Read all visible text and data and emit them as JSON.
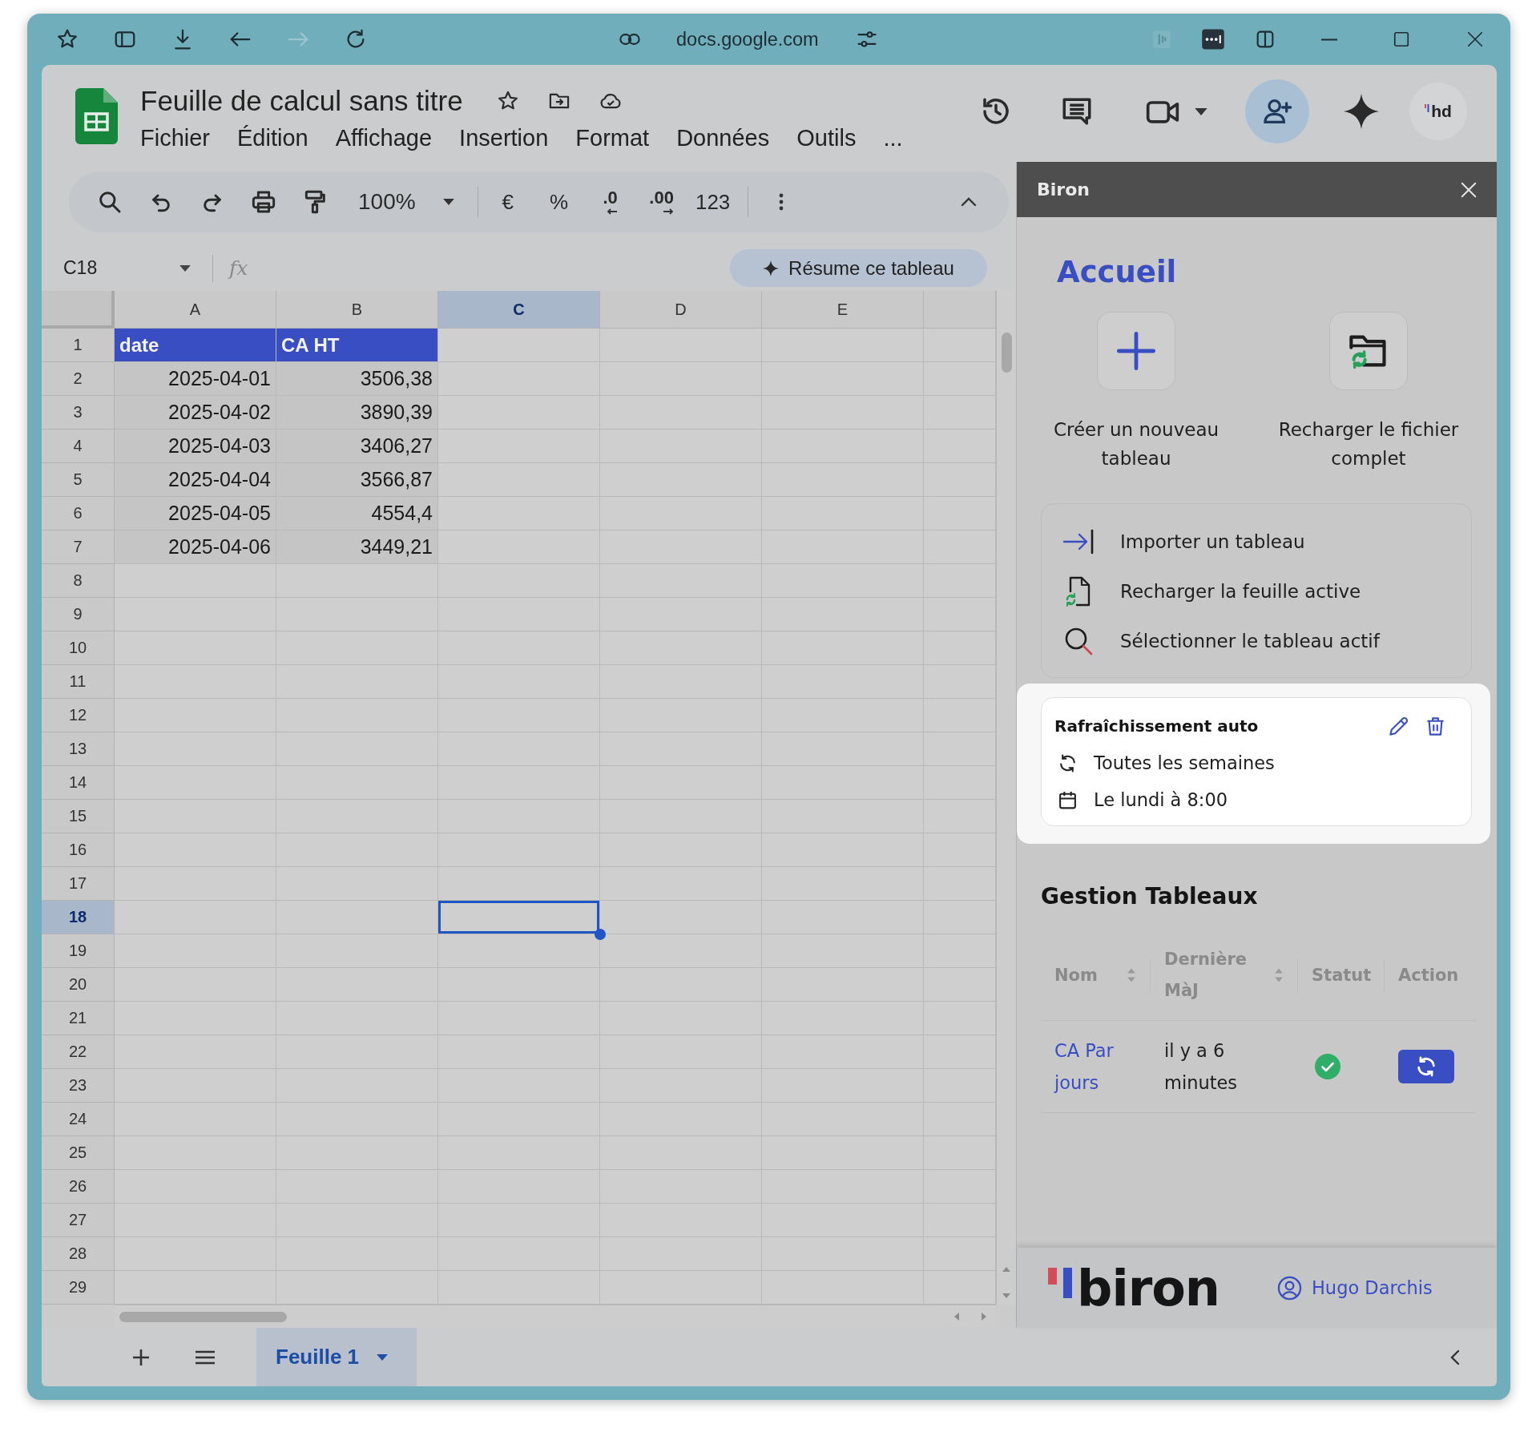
{
  "browser": {
    "url": "docs.google.com",
    "forward_enabled": false
  },
  "document": {
    "title": "Feuille de calcul sans titre",
    "menus": [
      "Fichier",
      "Édition",
      "Affichage",
      "Insertion",
      "Format",
      "Données",
      "Outils",
      "..."
    ],
    "avatar": "hd"
  },
  "toolbar": {
    "zoom": "100%",
    "formats": [
      {
        "label": "€",
        "kind": "plain"
      },
      {
        "label": "%",
        "kind": "plain"
      },
      {
        "label": ".0",
        "kind": "decrease"
      },
      {
        "label": ".00",
        "kind": "increase"
      },
      {
        "label": "123",
        "kind": "plain"
      }
    ]
  },
  "formula_bar": {
    "cell": "C18",
    "fx": "fx",
    "summary_button": "Résume ce tableau"
  },
  "grid": {
    "columns": [
      {
        "label": "A",
        "selected": false
      },
      {
        "label": "B",
        "selected": false
      },
      {
        "label": "C",
        "selected": true
      },
      {
        "label": "D",
        "selected": false
      },
      {
        "label": "E",
        "selected": false
      }
    ],
    "rows": [
      {
        "number": "1",
        "selected": false
      },
      {
        "number": "2",
        "selected": false
      },
      {
        "number": "3",
        "selected": false
      },
      {
        "number": "4",
        "selected": false
      },
      {
        "number": "5",
        "selected": false
      },
      {
        "number": "6",
        "selected": false
      },
      {
        "number": "7",
        "selected": false
      },
      {
        "number": "8",
        "selected": false
      },
      {
        "number": "9",
        "selected": false
      },
      {
        "number": "10",
        "selected": false
      },
      {
        "number": "11",
        "selected": false
      },
      {
        "number": "12",
        "selected": false
      },
      {
        "number": "13",
        "selected": false
      },
      {
        "number": "14",
        "selected": false
      },
      {
        "number": "15",
        "selected": false
      },
      {
        "number": "16",
        "selected": false
      },
      {
        "number": "17",
        "selected": false
      },
      {
        "number": "18",
        "selected": true
      },
      {
        "number": "19",
        "selected": false
      },
      {
        "number": "20",
        "selected": false
      },
      {
        "number": "21",
        "selected": false
      },
      {
        "number": "22",
        "selected": false
      },
      {
        "number": "23",
        "selected": false
      },
      {
        "number": "24",
        "selected": false
      },
      {
        "number": "25",
        "selected": false
      },
      {
        "number": "26",
        "selected": false
      },
      {
        "number": "27",
        "selected": false
      },
      {
        "number": "28",
        "selected": false
      },
      {
        "number": "29",
        "selected": false
      }
    ],
    "table": {
      "header": [
        "date",
        "CA HT"
      ],
      "rows": [
        [
          "2025-04-01",
          "3506,38"
        ],
        [
          "2025-04-02",
          "3890,39"
        ],
        [
          "2025-04-03",
          "3406,27"
        ],
        [
          "2025-04-04",
          "3566,87"
        ],
        [
          "2025-04-05",
          "4554,4"
        ],
        [
          "2025-04-06",
          "3449,21"
        ]
      ]
    }
  },
  "sidebar": {
    "title": "Biron",
    "heading": "Accueil",
    "tiles": [
      "Créer un nouveau tableau",
      "Recharger le fichier complet"
    ],
    "actions": [
      "Importer un tableau",
      "Recharger la feuille active",
      "Sélectionner le tableau actif"
    ],
    "auto_refresh": {
      "highlighted": true,
      "title": "Rafraîchissement auto",
      "frequency": "Toutes les semaines",
      "schedule": "Le lundi à 8:00"
    },
    "tables": {
      "title": "Gestion Tableaux",
      "columns": [
        {
          "label": "Nom",
          "sortable": true
        },
        {
          "label": "Dernière MàJ",
          "sortable": true
        },
        {
          "label": "Statut",
          "sortable": false
        },
        {
          "label": "Action",
          "sortable": false
        }
      ],
      "rows": [
        {
          "name": "CA Par jours",
          "updated": "il y a 6 minutes",
          "up_to_date": true
        }
      ]
    },
    "footer": {
      "brand": "biron",
      "user": "Hugo Darchis"
    }
  },
  "sheets": [
    {
      "name": "Feuille 1",
      "selected": true
    }
  ]
}
